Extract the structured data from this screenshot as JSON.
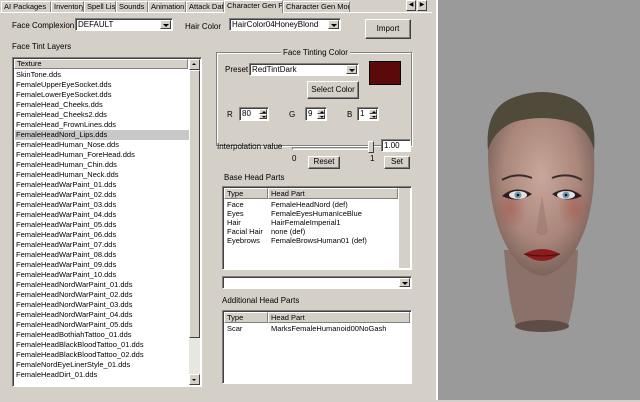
{
  "tabs": [
    "AI Packages",
    "Inventory",
    "Spell List",
    "Sounds",
    "Animation",
    "Attack Data",
    "Character Gen Parts",
    "Character Gen Morph"
  ],
  "active_tab": "Character Gen Parts",
  "face_complexion": {
    "label": "Face Complexion",
    "value": "DEFAULT"
  },
  "hair_color": {
    "label": "Hair Color",
    "value": "HairColor04HoneyBlond"
  },
  "import_label": "Import",
  "tint_layers": {
    "title": "Face Tint Layers",
    "column": "Texture",
    "items": [
      "SkinTone.dds",
      "FemaleUpperEyeSocket.dds",
      "FemaleLowerEyeSocket.dds",
      "FemaleHead_Cheeks.dds",
      "FemaleHead_Cheeks2.dds",
      "FemaleHead_FrownLines.dds",
      "FemaleHeadNord_Lips.dds",
      "FemaleHeadHuman_Nose.dds",
      "FemaleHeadHuman_ForeHead.dds",
      "FemaleHeadHuman_Chin.dds",
      "FemaleHeadHuman_Neck.dds",
      "FemaleHeadWarPaint_01.dds",
      "FemaleHeadWarPaint_02.dds",
      "FemaleHeadWarPaint_03.dds",
      "FemaleHeadWarPaint_04.dds",
      "FemaleHeadWarPaint_05.dds",
      "FemaleHeadWarPaint_06.dds",
      "FemaleHeadWarPaint_07.dds",
      "FemaleHeadWarPaint_08.dds",
      "FemaleHeadWarPaint_09.dds",
      "FemaleHeadWarPaint_10.dds",
      "FemaleHeadNordWarPaint_01.dds",
      "FemaleHeadNordWarPaint_02.dds",
      "FemaleHeadNordWarPaint_03.dds",
      "FemaleHeadNordWarPaint_04.dds",
      "FemaleHeadNordWarPaint_05.dds",
      "FemaleHeadBothiahTattoo_01.dds",
      "FemaleHeadBlackBloodTattoo_01.dds",
      "FemaleHeadBlackBloodTattoo_02.dds",
      "FemaleNordEyeLinerStyle_01.dds",
      "FemaleHeadDirt_01.dds"
    ],
    "selected_index": 6
  },
  "face_tinting": {
    "title": "Face Tinting Color",
    "preset_label": "Preset",
    "preset_value": "RedTintDark",
    "select_color_label": "Select Color",
    "swatch_color": "#5a0a08",
    "r_label": "R",
    "r_value": "80",
    "g_label": "G",
    "g_value": "9",
    "b_label": "B",
    "b_value": "1"
  },
  "interpolation": {
    "label": "Interpolation value",
    "value": "1.00",
    "min_label": "0",
    "max_label": "1",
    "level": 1.0,
    "reset_label": "Reset",
    "set_label": "Set"
  },
  "base_head_parts": {
    "title": "Base Head Parts",
    "col_type": "Type",
    "col_part": "Head Part",
    "rows": [
      {
        "type": "Face",
        "part": "FemaleHeadNord (def)"
      },
      {
        "type": "Eyes",
        "part": "FemaleEyesHumanIceBlue"
      },
      {
        "type": "Hair",
        "part": "HairFemaleImperial1"
      },
      {
        "type": "Facial Hair",
        "part": "none (def)"
      },
      {
        "type": "Eyebrows",
        "part": "FemaleBrowsHuman01 (def)"
      }
    ]
  },
  "head_part_combo_value": "",
  "additional_head_parts": {
    "title": "Additional Head Parts",
    "col_type": "Type",
    "col_part": "Head Part",
    "rows": [
      {
        "type": "Scar",
        "part": "MarksFemaleHumanoid00NoGash"
      }
    ]
  },
  "colors": {
    "window_bg": "#d4d0c8",
    "preview_bg": "#9a9a9a",
    "selection": "#c8c8c8"
  }
}
